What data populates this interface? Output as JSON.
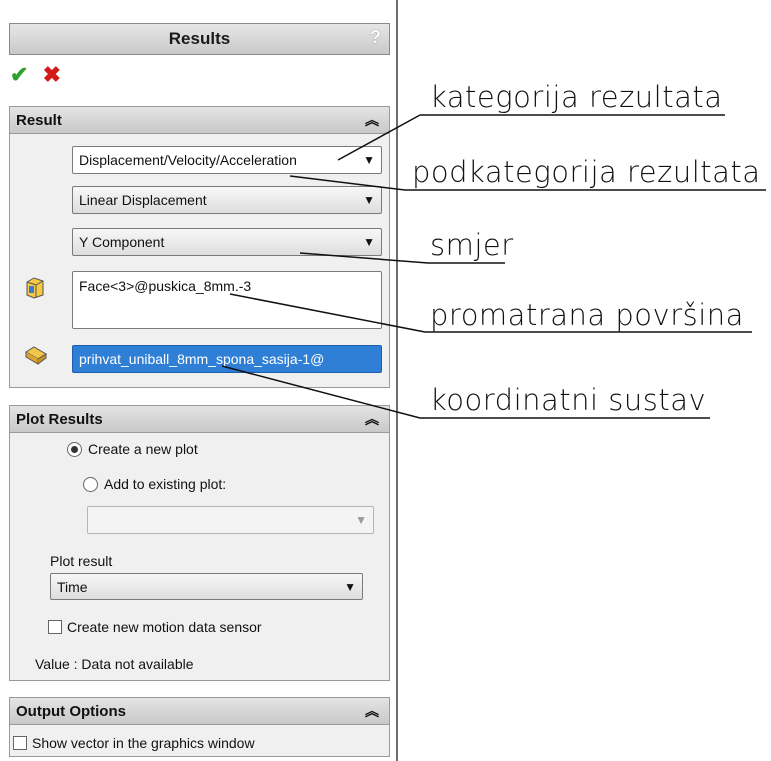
{
  "window": {
    "title": "Results",
    "help": "?"
  },
  "actions": {
    "ok": "✔",
    "cancel": "✖"
  },
  "result_group": {
    "title": "Result",
    "category": "Displacement/Velocity/Acceleration",
    "subcategory": "Linear Displacement",
    "component": "Y Component",
    "face": "Face<3>@puskica_8mm.-3",
    "coordinate": "prihvat_uniball_8mm_spona_sasija-1@"
  },
  "plot_group": {
    "title": "Plot Results",
    "radio_new": "Create a new plot",
    "radio_existing": "Add to existing plot:",
    "existing_plot_value": "",
    "plot_result_label": "Plot result",
    "plot_result_value": "Time",
    "sensor_checkbox": "Create new motion data sensor",
    "value_text": "Value : Data not available"
  },
  "output_group": {
    "title": "Output Options",
    "vector_checkbox": "Show vector in the graphics window"
  },
  "annotations": {
    "category": "kategorija rezultata",
    "subcategory": "podkategorija rezultata",
    "direction": "smjer",
    "surface": "promatrana površina",
    "coordinate_system": "koordinatni sustav"
  }
}
